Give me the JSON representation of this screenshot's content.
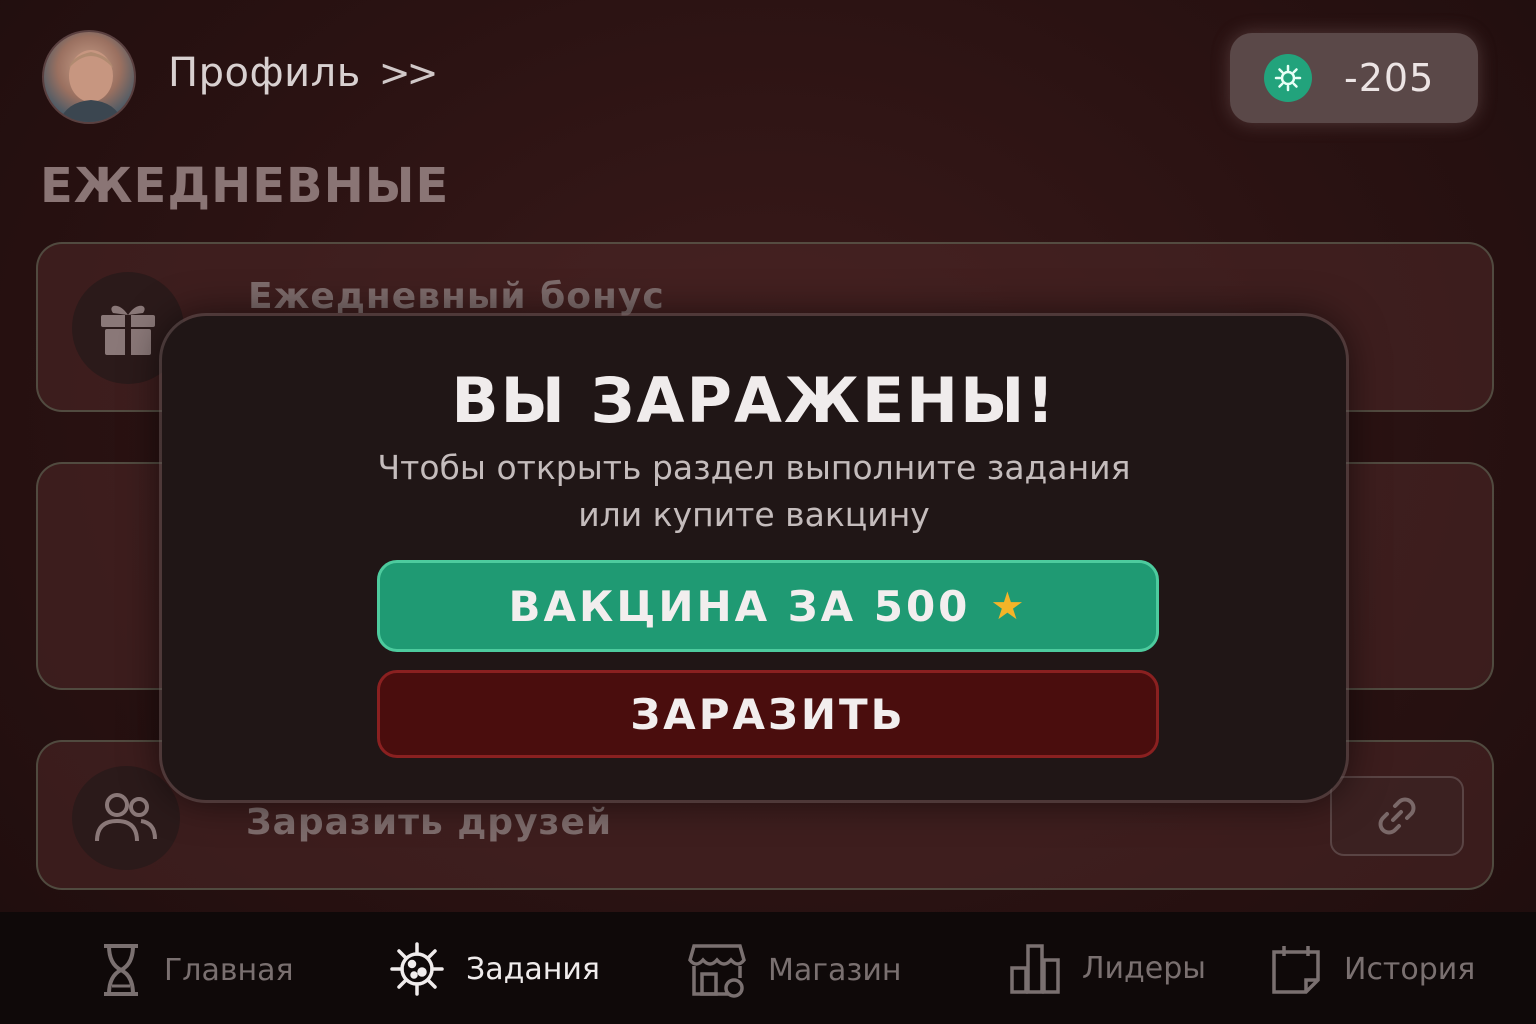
{
  "header": {
    "profile_label": "Профиль",
    "profile_chevron": ">>",
    "balance_value": "-205",
    "balance_icon": "virus-coin-icon"
  },
  "section": {
    "title": "ЕЖЕДНЕВНЫЕ"
  },
  "cards": {
    "daily_bonus": {
      "label": "Ежедневный бонус",
      "icon": "gift-icon"
    },
    "infect_friends": {
      "label": "Заразить друзей",
      "icon": "users-icon",
      "action_icon": "link-icon"
    }
  },
  "modal": {
    "title": "ВЫ ЗАРАЖЕНЫ!",
    "text_line1": "Чтобы открыть раздел выполните задания",
    "text_line2": "или купите вакцину",
    "vaccine_button": "ВАКЦИНА ЗА 500",
    "vaccine_icon": "star-icon",
    "infect_button": "ЗАРАЗИТЬ"
  },
  "nav": {
    "items": [
      {
        "label": "Главная",
        "icon": "hourglass-icon"
      },
      {
        "label": "Задания",
        "icon": "virus-icon",
        "active": true
      },
      {
        "label": "Магазин",
        "icon": "store-icon"
      },
      {
        "label": "Лидеры",
        "icon": "bar-chart-icon"
      },
      {
        "label": "История",
        "icon": "calendar-icon"
      }
    ]
  },
  "colors": {
    "accent_green": "#1f9a73",
    "danger_red": "#4a0d0d",
    "star": "#f4b428"
  }
}
